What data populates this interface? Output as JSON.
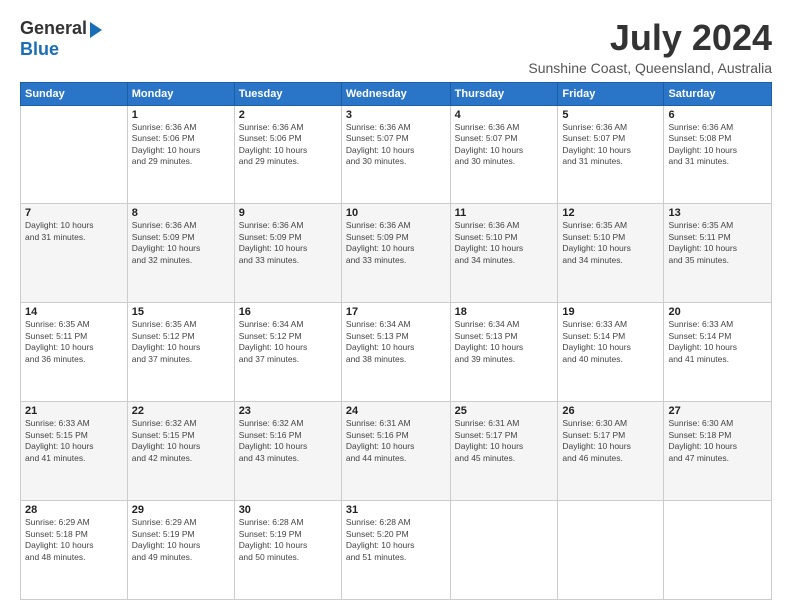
{
  "header": {
    "logo_general": "General",
    "logo_blue": "Blue",
    "title": "July 2024",
    "location": "Sunshine Coast, Queensland, Australia"
  },
  "days_of_week": [
    "Sunday",
    "Monday",
    "Tuesday",
    "Wednesday",
    "Thursday",
    "Friday",
    "Saturday"
  ],
  "weeks": [
    [
      {
        "day": "",
        "info": ""
      },
      {
        "day": "1",
        "info": "Sunrise: 6:36 AM\nSunset: 5:06 PM\nDaylight: 10 hours\nand 29 minutes."
      },
      {
        "day": "2",
        "info": "Sunrise: 6:36 AM\nSunset: 5:06 PM\nDaylight: 10 hours\nand 29 minutes."
      },
      {
        "day": "3",
        "info": "Sunrise: 6:36 AM\nSunset: 5:07 PM\nDaylight: 10 hours\nand 30 minutes."
      },
      {
        "day": "4",
        "info": "Sunrise: 6:36 AM\nSunset: 5:07 PM\nDaylight: 10 hours\nand 30 minutes."
      },
      {
        "day": "5",
        "info": "Sunrise: 6:36 AM\nSunset: 5:07 PM\nDaylight: 10 hours\nand 31 minutes."
      },
      {
        "day": "6",
        "info": "Sunrise: 6:36 AM\nSunset: 5:08 PM\nDaylight: 10 hours\nand 31 minutes."
      }
    ],
    [
      {
        "day": "7",
        "info": "Daylight: 10 hours\nand 31 minutes."
      },
      {
        "day": "8",
        "info": "Sunrise: 6:36 AM\nSunset: 5:09 PM\nDaylight: 10 hours\nand 32 minutes."
      },
      {
        "day": "9",
        "info": "Sunrise: 6:36 AM\nSunset: 5:09 PM\nDaylight: 10 hours\nand 33 minutes."
      },
      {
        "day": "10",
        "info": "Sunrise: 6:36 AM\nSunset: 5:09 PM\nDaylight: 10 hours\nand 33 minutes."
      },
      {
        "day": "11",
        "info": "Sunrise: 6:36 AM\nSunset: 5:10 PM\nDaylight: 10 hours\nand 34 minutes."
      },
      {
        "day": "12",
        "info": "Sunrise: 6:35 AM\nSunset: 5:10 PM\nDaylight: 10 hours\nand 34 minutes."
      },
      {
        "day": "13",
        "info": "Sunrise: 6:35 AM\nSunset: 5:11 PM\nDaylight: 10 hours\nand 35 minutes."
      }
    ],
    [
      {
        "day": "14",
        "info": "Sunrise: 6:35 AM\nSunset: 5:11 PM\nDaylight: 10 hours\nand 36 minutes."
      },
      {
        "day": "15",
        "info": "Sunrise: 6:35 AM\nSunset: 5:12 PM\nDaylight: 10 hours\nand 37 minutes."
      },
      {
        "day": "16",
        "info": "Sunrise: 6:34 AM\nSunset: 5:12 PM\nDaylight: 10 hours\nand 37 minutes."
      },
      {
        "day": "17",
        "info": "Sunrise: 6:34 AM\nSunset: 5:13 PM\nDaylight: 10 hours\nand 38 minutes."
      },
      {
        "day": "18",
        "info": "Sunrise: 6:34 AM\nSunset: 5:13 PM\nDaylight: 10 hours\nand 39 minutes."
      },
      {
        "day": "19",
        "info": "Sunrise: 6:33 AM\nSunset: 5:14 PM\nDaylight: 10 hours\nand 40 minutes."
      },
      {
        "day": "20",
        "info": "Sunrise: 6:33 AM\nSunset: 5:14 PM\nDaylight: 10 hours\nand 41 minutes."
      }
    ],
    [
      {
        "day": "21",
        "info": "Sunrise: 6:33 AM\nSunset: 5:15 PM\nDaylight: 10 hours\nand 41 minutes."
      },
      {
        "day": "22",
        "info": "Sunrise: 6:32 AM\nSunset: 5:15 PM\nDaylight: 10 hours\nand 42 minutes."
      },
      {
        "day": "23",
        "info": "Sunrise: 6:32 AM\nSunset: 5:16 PM\nDaylight: 10 hours\nand 43 minutes."
      },
      {
        "day": "24",
        "info": "Sunrise: 6:31 AM\nSunset: 5:16 PM\nDaylight: 10 hours\nand 44 minutes."
      },
      {
        "day": "25",
        "info": "Sunrise: 6:31 AM\nSunset: 5:17 PM\nDaylight: 10 hours\nand 45 minutes."
      },
      {
        "day": "26",
        "info": "Sunrise: 6:30 AM\nSunset: 5:17 PM\nDaylight: 10 hours\nand 46 minutes."
      },
      {
        "day": "27",
        "info": "Sunrise: 6:30 AM\nSunset: 5:18 PM\nDaylight: 10 hours\nand 47 minutes."
      }
    ],
    [
      {
        "day": "28",
        "info": "Sunrise: 6:29 AM\nSunset: 5:18 PM\nDaylight: 10 hours\nand 48 minutes."
      },
      {
        "day": "29",
        "info": "Sunrise: 6:29 AM\nSunset: 5:19 PM\nDaylight: 10 hours\nand 49 minutes."
      },
      {
        "day": "30",
        "info": "Sunrise: 6:28 AM\nSunset: 5:19 PM\nDaylight: 10 hours\nand 50 minutes."
      },
      {
        "day": "31",
        "info": "Sunrise: 6:28 AM\nSunset: 5:20 PM\nDaylight: 10 hours\nand 51 minutes."
      },
      {
        "day": "",
        "info": ""
      },
      {
        "day": "",
        "info": ""
      },
      {
        "day": "",
        "info": ""
      }
    ]
  ]
}
